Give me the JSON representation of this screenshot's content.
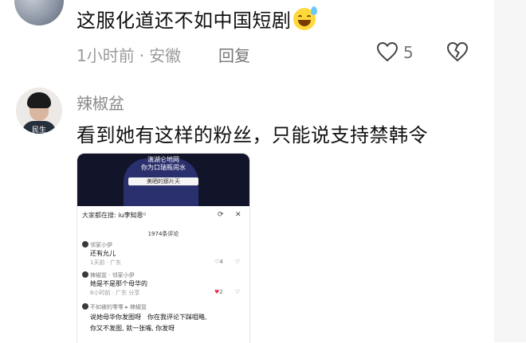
{
  "comment1": {
    "text": "这服化道还不如中国短剧",
    "emoji": "grinning-sweat-emoji",
    "time_ago": "1小时前",
    "separator": "·",
    "location": "安徽",
    "reply_label": "回复",
    "like_count": "5"
  },
  "comment2": {
    "username": "辣椒盆",
    "avatar_tag": "民生",
    "text": "看到她有这样的粉丝，只能说支持禁韩令"
  },
  "embed": {
    "video_sub1": "演湖仑地网",
    "video_sub2": "你为口瑞瓶闹水",
    "video_badge": "美晒的那片天",
    "search_prefix": "大家都在搜:",
    "search_term": "iu李知恩",
    "search_mark": "ᴳ",
    "count_title": "1974条评论",
    "comments": [
      {
        "name": "邻家小伊",
        "body": "还有允儿",
        "meta": "1天前 · 广东",
        "likes": "4"
      },
      {
        "name": "辣椒盆  · 邻家小伊",
        "body": "她是不是那个母华的",
        "meta": "6小时前 · 广东    分享",
        "likes": "2"
      },
      {
        "name": "不如被的零零  ▸ 辣椒盆",
        "body": "说她母华你发图呀",
        "body2": "你在我评论下踩咀略,",
        "body3": "你又不发图, 就一张嘴, 你发呀",
        "meta": "",
        "likes": ""
      }
    ]
  },
  "colors": {
    "accent_red": "#e8344a",
    "meta_gray": "#9a9a9a"
  }
}
